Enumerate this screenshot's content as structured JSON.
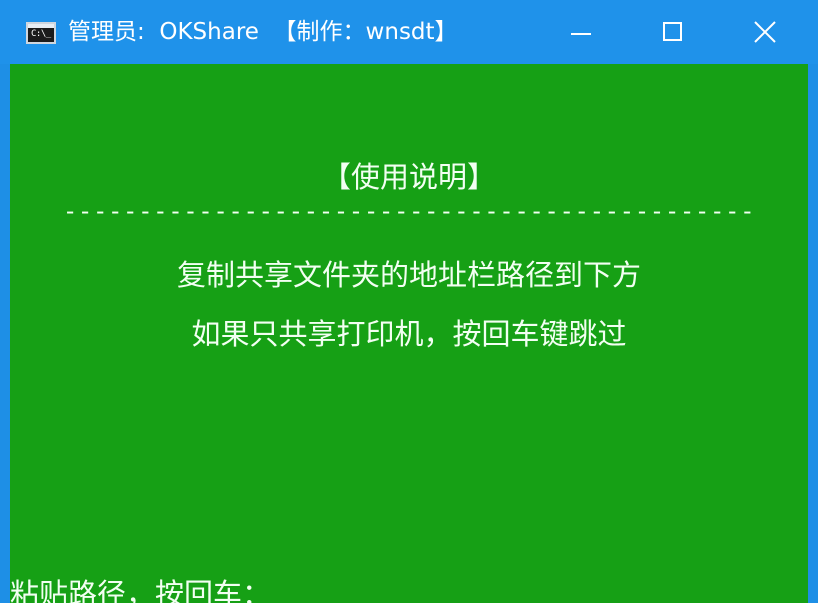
{
  "window": {
    "title": "管理员:  OKShare  【制作：wnsdt】",
    "icon": "cmd-console-icon",
    "controls": {
      "minimize": "minimize-icon",
      "maximize": "maximize-icon",
      "close": "close-icon"
    }
  },
  "console": {
    "background_color": "#16a015",
    "text_color": "#f2fff2",
    "heading": "【使用说明】",
    "divider": "----------------------------------------------",
    "lines": [
      "复制共享文件夹的地址栏路径到下方",
      "如果只共享打印机，按回车键跳过"
    ],
    "prompt": "粘贴路径，按回车："
  }
}
